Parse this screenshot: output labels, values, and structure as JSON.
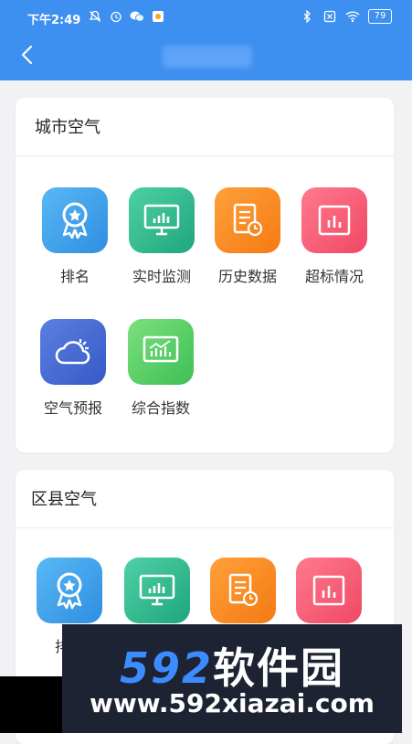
{
  "status_bar": {
    "time": "下午2:49",
    "battery": "79"
  },
  "header": {
    "back_icon": "chevron-left-icon"
  },
  "sections": [
    {
      "title": "城市空气",
      "items": [
        {
          "label": "排名",
          "icon": "ribbon-star-icon",
          "color": "#3f9eea"
        },
        {
          "label": "实时监测",
          "icon": "monitor-chart-icon",
          "color": "#2bb88a"
        },
        {
          "label": "历史数据",
          "icon": "document-clock-icon",
          "color": "#f58a22"
        },
        {
          "label": "超标情况",
          "icon": "bar-chart-icon",
          "color": "#f25a72"
        },
        {
          "label": "空气预报",
          "icon": "cloud-sun-icon",
          "color": "#4468d0"
        },
        {
          "label": "综合指数",
          "icon": "monitor-chart-icon",
          "color": "#52c766"
        }
      ]
    },
    {
      "title": "区县空气",
      "items": [
        {
          "label": "排名",
          "icon": "ribbon-star-icon",
          "color": "#3f9eea"
        },
        {
          "icon": "monitor-chart-icon",
          "color": "#2bb88a"
        },
        {
          "icon": "document-clock-icon",
          "color": "#f58a22"
        },
        {
          "icon": "bar-chart-icon",
          "color": "#f25a72"
        }
      ]
    }
  ],
  "watermark": {
    "brand_number": "592",
    "brand_text": "软件园",
    "url": "www.592xiazai.com"
  }
}
